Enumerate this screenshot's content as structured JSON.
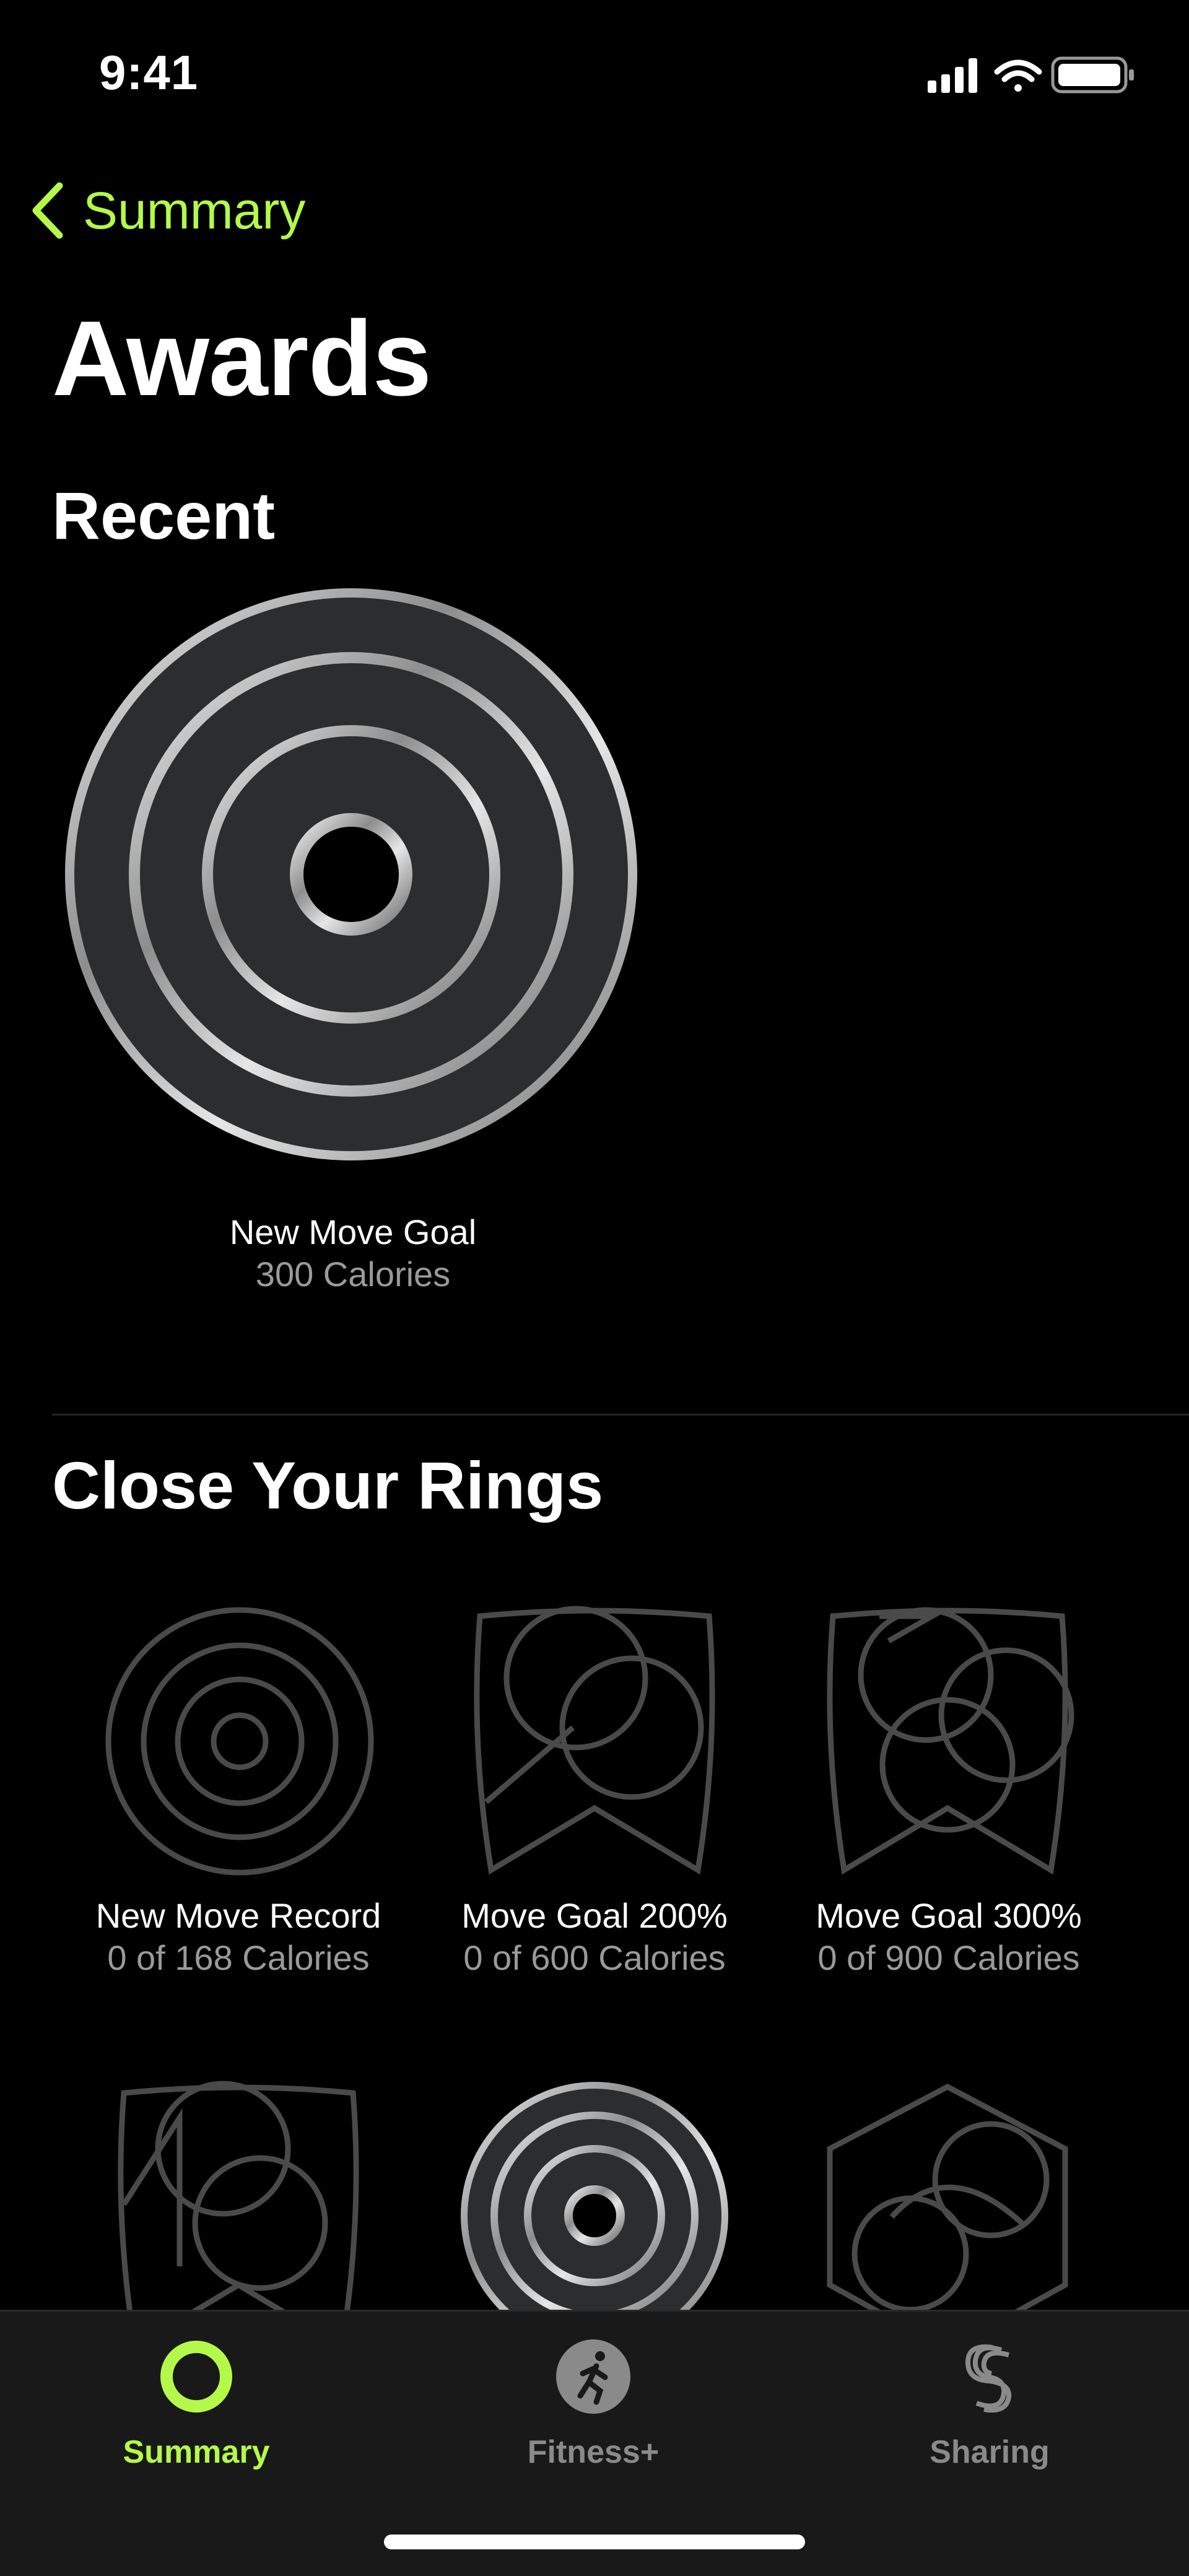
{
  "status": {
    "time": "9:41"
  },
  "nav": {
    "back_label": "Summary"
  },
  "title": "Awards",
  "sections": {
    "recent": "Recent",
    "close_rings": "Close Your Rings"
  },
  "recent_award": {
    "title": "New Move Goal",
    "subtitle": "300 Calories"
  },
  "ring_awards": [
    {
      "title": "New Move Record",
      "subtitle": "0 of 168 Calories"
    },
    {
      "title": "Move Goal 200%",
      "subtitle": "0 of 600 Calories"
    },
    {
      "title": "Move Goal 300%",
      "subtitle": "0 of 900 Calories"
    }
  ],
  "tabs": [
    {
      "label": "Summary",
      "icon": "activity-ring-icon",
      "active": true
    },
    {
      "label": "Fitness+",
      "icon": "runner-icon",
      "active": false
    },
    {
      "label": "Sharing",
      "icon": "sharing-icon",
      "active": false
    }
  ],
  "colors": {
    "accent": "#b4f94a",
    "background": "#000000",
    "tabbar": "#191919"
  }
}
